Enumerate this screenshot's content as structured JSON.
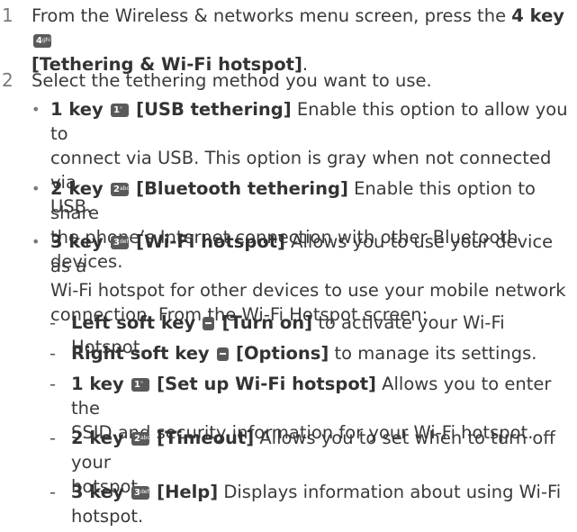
{
  "step1": {
    "number": "1",
    "line1_pre": "From the Wireless & networks menu screen, press the ",
    "line1_key": "4 key",
    "line1_label": "[Tethering & Wi-Fi hotspot]",
    "line1_end": "."
  },
  "step2": {
    "number": "2",
    "intro": "Select the tethering method you want to use."
  },
  "bullets": [
    {
      "key": "1 key",
      "label": "[USB tethering]",
      "text_l1": " Enable this option to allow you to",
      "text_l2": "connect via USB. This option is gray when not connected via",
      "text_l3": "USB."
    },
    {
      "key": "2 key",
      "label": "[Bluetooth tethering]",
      "text_l1": " Enable this option to share",
      "text_l2": "the phone’s Internet connection with other Bluetooth devices."
    },
    {
      "key": "3 key",
      "label": "[Wi-Fi hotspot]",
      "text_l1": " Allows you to use your device as a",
      "text_l2": "Wi-Fi hotspot for other devices to use your mobile network",
      "text_l3": "connection. From the Wi-Fi Hotspot screen:"
    }
  ],
  "sub_items": [
    {
      "key": "Left soft key",
      "label": "[Turn on]",
      "text_l1": " to activate your Wi-Fi Hotspot."
    },
    {
      "key": "Right soft key",
      "label": "[Options]",
      "text_l1": " to manage its settings."
    },
    {
      "key": "1 key",
      "label": "[Set up Wi-Fi hotspot]",
      "text_l1": " Allows you to enter the",
      "text_l2": "SSID and security information for your Wi-Fi hotspot."
    },
    {
      "key": "2 key",
      "label": "[Timeout]",
      "text_l1": " Allows you to set when to turn off your",
      "text_l2": "hotspot."
    },
    {
      "key": "3 key",
      "label": "[Help]",
      "text_l1": " Displays information about using Wi-Fi",
      "text_l2": "hotspot."
    }
  ],
  "keypad_glyphs": {
    "key1": "1",
    "key1_sub": "°",
    "key2": "2",
    "key2_sub": "abc",
    "key3": "3",
    "key3_sub": "def",
    "key4": "4",
    "key4_sub": "ghi"
  },
  "markers": {
    "bullet": "•",
    "dash": "-"
  }
}
